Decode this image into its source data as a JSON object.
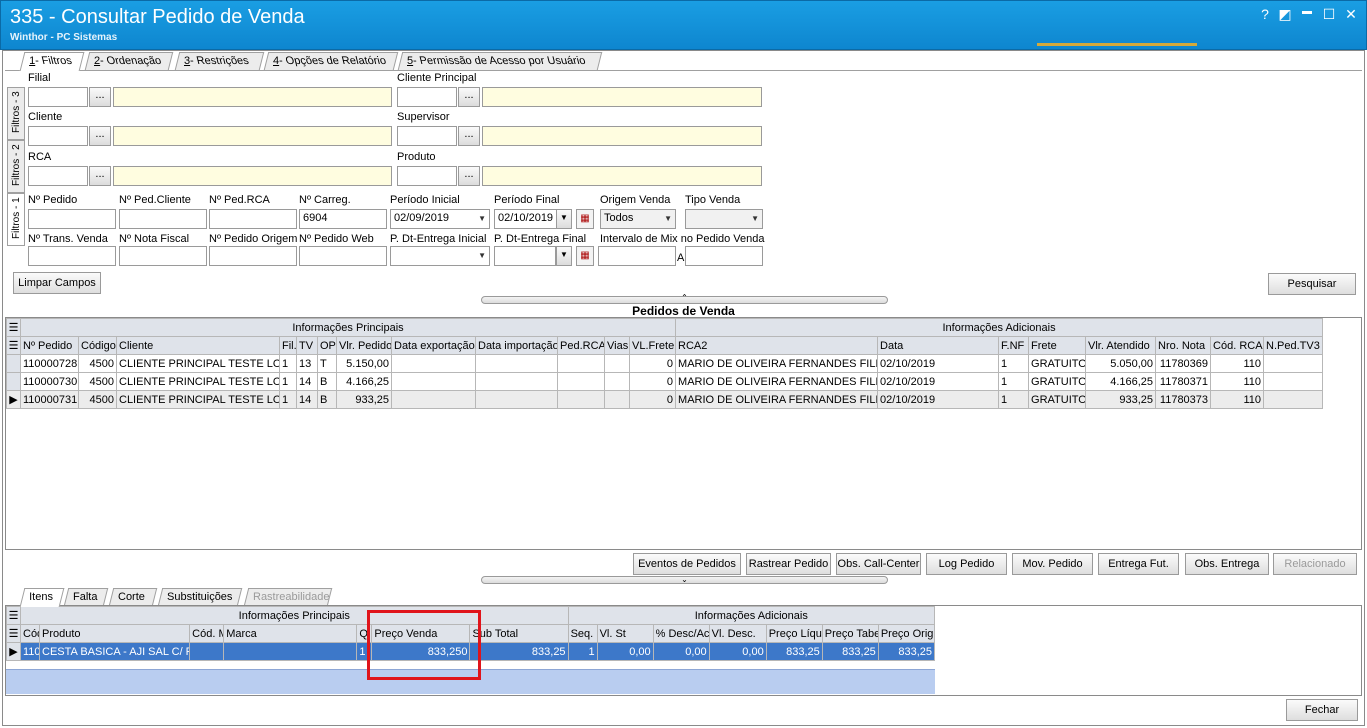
{
  "window": {
    "title": "335 - Consultar Pedido de Venda",
    "subtitle": "Winthor - PC Sistemas",
    "help": "?",
    "minimize": "▬",
    "restore": "☐",
    "close": "✕",
    "paint": "◩"
  },
  "tabs": [
    {
      "key": "1",
      "label": " - Filtros"
    },
    {
      "key": "2",
      "label": " - Ordenação"
    },
    {
      "key": "3",
      "label": " - Restrições"
    },
    {
      "key": "4",
      "label": " - Opções de Relatório"
    },
    {
      "key": "5",
      "label": " - Permissão de Acesso por Usuário"
    }
  ],
  "side_tabs": [
    "Filtros - 1",
    "Filtros - 2",
    "Filtros - 3"
  ],
  "filters": {
    "filial": "Filial",
    "cliente_principal": "Cliente Principal",
    "cliente": "Cliente",
    "supervisor": "Supervisor",
    "rca": "RCA",
    "produto": "Produto",
    "ellipsis": "...",
    "num_pedido": "Nº Pedido",
    "num_ped_cliente": "Nº Ped.Cliente",
    "num_ped_rca": "Nº Ped.RCA",
    "num_carreg": "Nº Carreg.",
    "num_carreg_value": "6904",
    "periodo_inicial": "Período Inicial",
    "periodo_inicial_value": "02/09/2019",
    "periodo_final": "Período Final",
    "periodo_final_value": "02/10/2019",
    "origem_venda": "Origem Venda",
    "origem_venda_value": "Todos",
    "tipo_venda": "Tipo Venda",
    "num_trans_venda": "Nº Trans. Venda",
    "num_nota_fiscal": "Nº Nota Fiscal",
    "num_pedido_origem": "Nº Pedido Origem",
    "num_pedido_web": "Nº Pedido Web",
    "p_dt_entrega_inicial": "P. Dt-Entrega Inicial",
    "p_dt_entrega_final": "P. Dt-Entrega Final",
    "intervalo_mix": "Intervalo de Mix no Pedido Venda",
    "a": "A"
  },
  "buttons": {
    "limpar": "Limpar Campos",
    "pesquisar": "Pesquisar",
    "eventos": "Eventos de Pedidos",
    "rastrear": "Rastrear Pedido",
    "obs_call": "Obs. Call-Center",
    "log": "Log Pedido",
    "mov": "Mov. Pedido",
    "entrega_fut": "Entrega Fut.",
    "obs_entrega": "Obs. Entrega",
    "relacionado": "Relacionado",
    "fechar": "Fechar"
  },
  "pedidos": {
    "title": "Pedidos de  Venda",
    "group_main": "Informações Principais",
    "group_add": "Informações Adicionais",
    "columns": [
      "Nº Pedido",
      "Código",
      "Cliente",
      "Fil.",
      "TV",
      "OP",
      "Vlr. Pedido",
      "Data exportação",
      "Data importação",
      "Ped.RCA",
      "Vias",
      "VL.Frete",
      "RCA2",
      "Data",
      "F.NF",
      "Frete",
      "Vlr. Atendido",
      "Nro. Nota",
      "Cód. RCA",
      "N.Ped.TV3"
    ],
    "rows": [
      [
        "110000728",
        "4500",
        "CLIENTE PRINCIPAL TESTE LOCA",
        "1",
        "13",
        "T",
        "5.150,00",
        "",
        "",
        "",
        "",
        "0",
        "MARIO DE OLIVEIRA FERNANDES FILHO",
        "02/10/2019",
        "1",
        "GRATUITO",
        "5.050,00",
        "11780369",
        "110",
        ""
      ],
      [
        "110000730",
        "4500",
        "CLIENTE PRINCIPAL TESTE LOCA",
        "1",
        "14",
        "B",
        "4.166,25",
        "",
        "",
        "",
        "",
        "0",
        "MARIO DE OLIVEIRA FERNANDES FILHO",
        "02/10/2019",
        "1",
        "GRATUITO",
        "4.166,25",
        "11780371",
        "110",
        ""
      ],
      [
        "110000731",
        "4500",
        "CLIENTE PRINCIPAL TESTE LOCA",
        "1",
        "14",
        "B",
        "933,25",
        "",
        "",
        "",
        "",
        "0",
        "MARIO DE OLIVEIRA FERNANDES FILHO",
        "02/10/2019",
        "1",
        "GRATUITO",
        "933,25",
        "11780373",
        "110",
        ""
      ]
    ]
  },
  "bottom_tabs": [
    "Itens",
    "Falta",
    "Corte",
    "Substituições",
    "Rastreabilidade"
  ],
  "itens": {
    "group_main": "Informações Principais",
    "group_add": "Informações Adicionais",
    "columns": [
      "Cód",
      "Produto",
      "Cód. M",
      "Marca",
      "Q",
      "Preço Venda",
      "Sub Total",
      "Seq.",
      "Vl. St",
      "% Desc/Ac",
      "Vl. Desc.",
      "Preço Líqu",
      "Preço Tabe",
      "Preço Orig"
    ],
    "row": [
      "110",
      "CESTA BASICA - AJI SAL C/ PI",
      "",
      "",
      "1",
      "833,250",
      "833,25",
      "1",
      "0,00",
      "0,00",
      "0,00",
      "833,25",
      "833,25",
      "833,25"
    ]
  },
  "colors": {
    "title_bar": "#1592d6",
    "selected_row": "#3d78c9",
    "highlight_box": "#e0141b"
  }
}
